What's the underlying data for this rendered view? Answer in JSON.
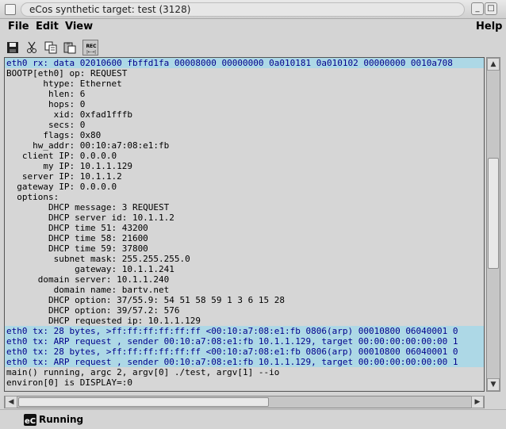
{
  "window": {
    "title": "eCos synthetic target: test (3128)",
    "buttons": {
      "minimize": "_",
      "maximize": "□",
      "close": "✕"
    }
  },
  "menubar": {
    "file": "File",
    "edit": "Edit",
    "view": "View",
    "help": "Help"
  },
  "toolbar": {
    "icons": [
      "save-icon",
      "cut-icon",
      "copy-icon",
      "paste-icon",
      "rec-icon"
    ],
    "rec_label_top": "REC",
    "rec_label_bottom": "|←→|"
  },
  "output": {
    "lines": [
      {
        "text": "eth0 rx: data 02010600 fbffd1fa 00008000 00000000 0a010181 0a010102 00000000 0010a708",
        "hl": true
      },
      {
        "text": "BOOTP[eth0] op: REQUEST",
        "hl": false
      },
      {
        "text": "       htype: Ethernet",
        "hl": false
      },
      {
        "text": "        hlen: 6",
        "hl": false
      },
      {
        "text": "        hops: 0",
        "hl": false
      },
      {
        "text": "         xid: 0xfad1fffb",
        "hl": false
      },
      {
        "text": "        secs: 0",
        "hl": false
      },
      {
        "text": "       flags: 0x80",
        "hl": false
      },
      {
        "text": "     hw_addr: 00:10:a7:08:e1:fb",
        "hl": false
      },
      {
        "text": "   client IP: 0.0.0.0",
        "hl": false
      },
      {
        "text": "       my IP: 10.1.1.129",
        "hl": false
      },
      {
        "text": "   server IP: 10.1.1.2",
        "hl": false
      },
      {
        "text": "  gateway IP: 0.0.0.0",
        "hl": false
      },
      {
        "text": "  options:",
        "hl": false
      },
      {
        "text": "        DHCP message: 3 REQUEST",
        "hl": false
      },
      {
        "text": "        DHCP server id: 10.1.1.2",
        "hl": false
      },
      {
        "text": "        DHCP time 51: 43200",
        "hl": false
      },
      {
        "text": "        DHCP time 58: 21600",
        "hl": false
      },
      {
        "text": "        DHCP time 59: 37800",
        "hl": false
      },
      {
        "text": "         subnet mask: 255.255.255.0",
        "hl": false
      },
      {
        "text": "             gateway: 10.1.1.241",
        "hl": false
      },
      {
        "text": "      domain server: 10.1.1.240",
        "hl": false
      },
      {
        "text": "         domain name: bartv.net",
        "hl": false
      },
      {
        "text": "        DHCP option: 37/55.9: 54 51 58 59 1 3 6 15 28",
        "hl": false
      },
      {
        "text": "        DHCP option: 39/57.2: 576",
        "hl": false
      },
      {
        "text": "        DHCP requested ip: 10.1.1.129",
        "hl": false
      },
      {
        "text": "eth0 tx: 28 bytes, >ff:ff:ff:ff:ff:ff <00:10:a7:08:e1:fb 0806(arp) 00010800 06040001 0",
        "hl": true
      },
      {
        "text": "eth0 tx: ARP request , sender 00:10:a7:08:e1:fb 10.1.1.129, target 00:00:00:00:00:00 1",
        "hl": true
      },
      {
        "text": "eth0 tx: 28 bytes, >ff:ff:ff:ff:ff:ff <00:10:a7:08:e1:fb 0806(arp) 00010800 06040001 0",
        "hl": true
      },
      {
        "text": "eth0 tx: ARP request , sender 00:10:a7:08:e1:fb 10.1.1.129, target 00:00:00:00:00:00 1",
        "hl": true
      },
      {
        "text": "main() running, argc 2, argv[0] ./test, argv[1] --io",
        "hl": false
      },
      {
        "text": "environ[0] is DISPLAY=:0",
        "hl": false
      }
    ]
  },
  "status": {
    "logo": "eC",
    "text": "Running"
  },
  "colors": {
    "highlight_bg": "#add8e6",
    "highlight_fg": "#00008b",
    "pane_bg": "#d6d6d6"
  }
}
